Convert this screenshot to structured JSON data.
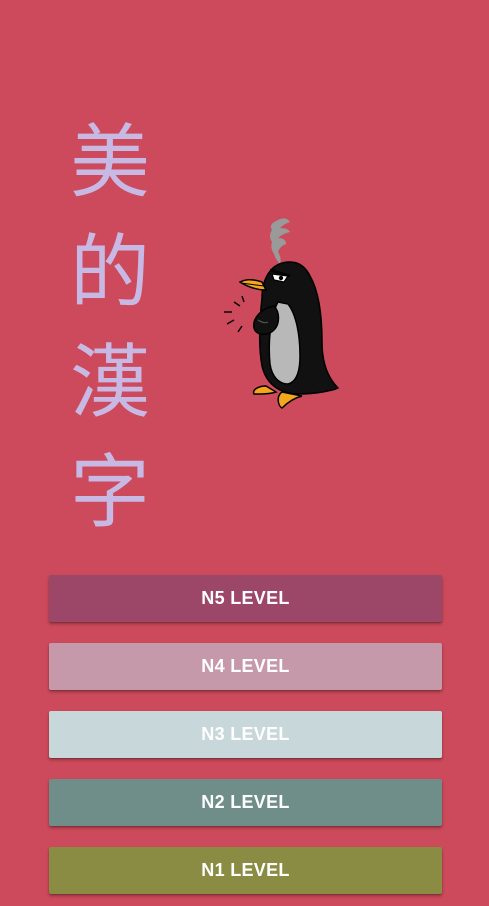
{
  "app": {
    "title_chars": [
      "美",
      "的",
      "漢",
      "字"
    ]
  },
  "levels": [
    {
      "label": "N5 LEVEL",
      "color": "#9c4767"
    },
    {
      "label": "N4 LEVEL",
      "color": "#c599aa"
    },
    {
      "label": "N3 LEVEL",
      "color": "#c8d7da"
    },
    {
      "label": "N2 LEVEL",
      "color": "#708e89"
    },
    {
      "label": "N1 LEVEL",
      "color": "#8a8c44"
    }
  ],
  "mascot": {
    "icon": "angry-penguin-icon"
  },
  "colors": {
    "background": "#cc4a5b",
    "title_text": "#c8b9e4",
    "button_text": "#ffffff"
  }
}
